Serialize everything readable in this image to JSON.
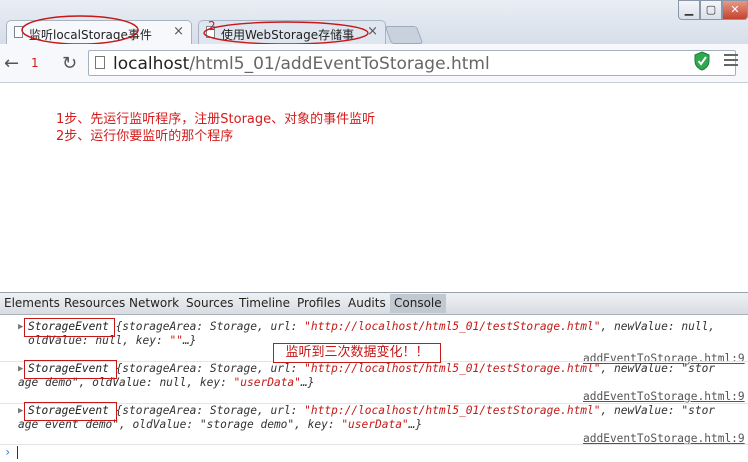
{
  "browser": {
    "tabs": [
      {
        "label": "监听localStorage事件",
        "close": "×"
      },
      {
        "label": "使用WebStorage存储事",
        "close": "×"
      }
    ],
    "step_marks": [
      "1",
      "2"
    ],
    "url_host": "localhost",
    "url_path": "/html5_01/addEventToStorage.html"
  },
  "page": {
    "instructions": [
      "1步、先运行监听程序，注册Storage、对象的事件监听",
      "2步、运行你要监听的那个程序"
    ]
  },
  "devtools": {
    "tabs": [
      "Elements",
      "Resources",
      "Network",
      "Sources",
      "Timeline",
      "Profiles",
      "Audits",
      "Console"
    ],
    "active_tab": "Console",
    "annotation": "监听到三次数据变化！！",
    "source": "addEventToStorage.html:9",
    "entries": [
      {
        "name": "StorageEvent",
        "l1_a": " {storageArea: Storage, url: ",
        "l1_url": "\"http://localhost/html5_01/testStorage.html\"",
        "l1_b": ", newValue: null,",
        "l2_a": "oldValue: null, key: ",
        "l2_key": "\"\"",
        "l2_b": "…}"
      },
      {
        "name": "StorageEvent",
        "l1_a": " {storageArea: Storage, url: ",
        "l1_url": "\"http://localhost/html5_01/testStorage.html\"",
        "l1_b": ", newValue: \"stor",
        "l2_a": "age demo\", oldValue: null, key: ",
        "l2_key": "\"userData\"",
        "l2_b": "…}"
      },
      {
        "name": "StorageEvent",
        "l1_a": " {storageArea: Storage, url: ",
        "l1_url": "\"http://localhost/html5_01/testStorage.html\"",
        "l1_b": ", newValue: \"stor",
        "l2_a": "age event demo\", oldValue: \"storage demo\", key: ",
        "l2_key": "\"userData\"",
        "l2_b": "…}"
      }
    ],
    "prompt": "›"
  },
  "colors": {
    "annotation_red": "#c71818",
    "string_red": "#c41a16",
    "link_blue": "#3a7ad5"
  }
}
